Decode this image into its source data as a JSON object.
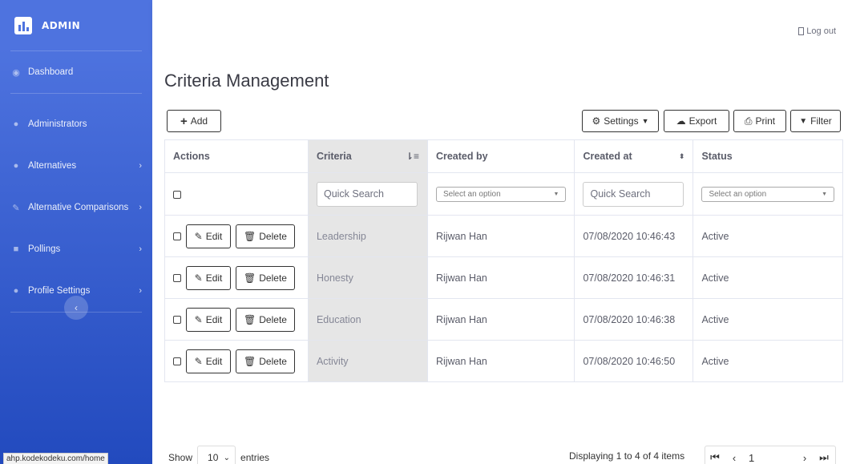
{
  "sidebar": {
    "brand": "ADMIN",
    "items": [
      {
        "label": "Dashboard",
        "icon": "dashboard-icon"
      },
      {
        "label": "Administrators",
        "icon": "users-icon"
      },
      {
        "label": "Alternatives",
        "icon": "group-icon"
      },
      {
        "label": "Alternative Comparisons",
        "icon": "edit-icon"
      },
      {
        "label": "Pollings",
        "icon": "poll-icon"
      },
      {
        "label": "Profile Settings",
        "icon": "user-cog-icon"
      }
    ],
    "toggle": "‹",
    "status_url": "ahp.kodekodeku.com/home"
  },
  "topbar": {
    "logout": "Log out"
  },
  "page": {
    "title": "Criteria Management"
  },
  "toolbar": {
    "add": "Add",
    "settings": "Settings",
    "export": "Export",
    "print": "Print",
    "filter": "Filter"
  },
  "table": {
    "headers": {
      "actions": "Actions",
      "criteria": "Criteria",
      "created_by": "Created by",
      "created_at": "Created at",
      "status": "Status"
    },
    "filters": {
      "quick_search": "Quick Search",
      "select_option": "Select an option"
    },
    "edit_label": "Edit",
    "delete_label": "Delete",
    "rows": [
      {
        "criteria": "Leadership",
        "created_by": "Rijwan Han",
        "created_at": "07/08/2020 10:46:43",
        "status": "Active"
      },
      {
        "criteria": "Honesty",
        "created_by": "Rijwan Han",
        "created_at": "07/08/2020 10:46:31",
        "status": "Active"
      },
      {
        "criteria": "Education",
        "created_by": "Rijwan Han",
        "created_at": "07/08/2020 10:46:38",
        "status": "Active"
      },
      {
        "criteria": "Activity",
        "created_by": "Rijwan Han",
        "created_at": "07/08/2020 10:46:50",
        "status": "Active"
      }
    ]
  },
  "footer": {
    "show": "Show",
    "length": "10",
    "entries": "entries",
    "displaying": "Displaying 1 to 4 of 4 items",
    "page": "1"
  },
  "colors": {
    "sidebar_start": "#4e73df",
    "sidebar_end": "#224abe",
    "criteria_col": "#e6e6e6"
  }
}
